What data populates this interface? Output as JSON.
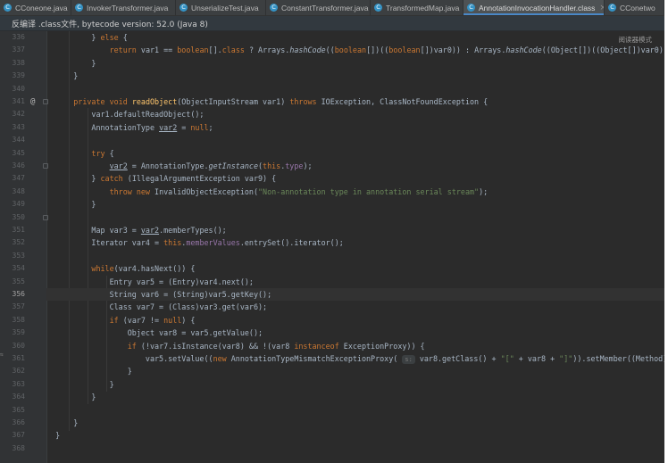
{
  "tabs": [
    {
      "label": "CConeone.java",
      "icon": "C"
    },
    {
      "label": "InvokerTransformer.java",
      "icon": "C"
    },
    {
      "label": "UnserializeTest.java",
      "icon": "C"
    },
    {
      "label": "ConstantTransformer.java",
      "icon": "C"
    },
    {
      "label": "TransformedMap.java",
      "icon": "C"
    },
    {
      "label": "AnnotationInvocationHandler.class",
      "icon": "C"
    },
    {
      "label": "CConetwo",
      "icon": "C"
    }
  ],
  "notice": "反编译 .class文件, bytecode version: 52.0 (Java 8)",
  "reader_mode": "阅读器模式",
  "line_numbers": [
    "336",
    "337",
    "338",
    "339",
    "340",
    "341",
    "342",
    "343",
    "344",
    "345",
    "346",
    "347",
    "348",
    "349",
    "350",
    "351",
    "352",
    "353",
    "354",
    "355",
    "356",
    "357",
    "358",
    "359",
    "360",
    "361",
    "362",
    "363",
    "364",
    "365",
    "366",
    "367",
    "368"
  ],
  "current_line": "356",
  "inlay_hint": "s:",
  "colors": {
    "background": "#2b2b2b",
    "keyword": "#cc7832",
    "method": "#ffc66d",
    "field": "#9876aa",
    "string": "#6a8759",
    "text": "#a9b7c6",
    "tab_active_underline": "#4a88c7"
  }
}
